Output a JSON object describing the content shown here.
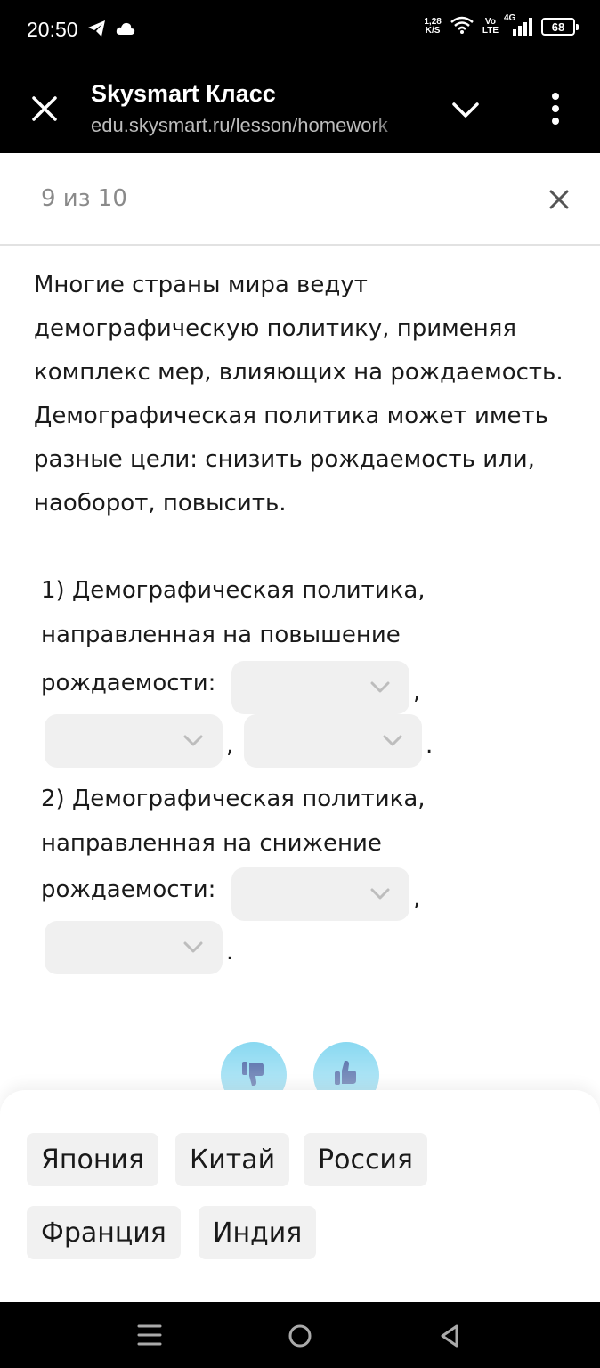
{
  "status_bar": {
    "time": "20:50",
    "net_speed_value": "1,28",
    "net_speed_unit": "K/S",
    "volte_top": "Vo",
    "volte_bottom": "LTE",
    "network_type": "4G",
    "battery": "68",
    "icons": [
      "telegram-icon",
      "cloud-icon",
      "wifi-icon",
      "signal-icon",
      "battery-icon"
    ]
  },
  "browser": {
    "title": "Skysmart Класс",
    "url": "edu.skysmart.ru/lesson/homework"
  },
  "lesson": {
    "progress": "9 из 10",
    "intro": "Многие страны мира ведут демографическую политику, применяя комплекс мер, влияющих на рождаемость. Демографическая политика может иметь разные цели: снизить рождаемость или, наоборот, повысить.",
    "task1": {
      "line1": "1) Демографическая политика,",
      "line2": "направленная на повышение",
      "line3": "рождаемости:"
    },
    "task2": {
      "line1": "2) Демографическая политика,",
      "line2": "направленная на снижение",
      "line3": "рождаемости:"
    },
    "comma": ",",
    "period": "."
  },
  "answer_bank": {
    "options": [
      "Япония",
      "Китай",
      "Россия",
      "Франция",
      "Индия"
    ]
  },
  "colors": {
    "accent": "#6fd0ee",
    "select_bg": "#f0f0f0",
    "chip_bg": "#f1f1f1",
    "text": "#1a1a1a",
    "muted": "#8a8a8a"
  }
}
